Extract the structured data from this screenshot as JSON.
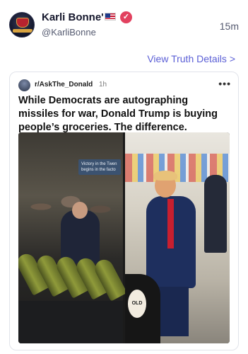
{
  "header": {
    "display_name": "Karli Bonne'",
    "handle": "@KarliBonne",
    "timestamp": "15m",
    "verified_badge": "check-icon",
    "flag": "us-flag-icon"
  },
  "actions": {
    "view_details_label": "View Truth Details",
    "view_details_chevron": ">"
  },
  "embedded_post": {
    "subreddit": "r/AskThe_Donald",
    "age": "1h",
    "menu_glyph": "•••",
    "title": "While Democrats are autographing missiles for war, Donald Trump is buying people’s groceries. The difference.",
    "image_left": {
      "sign_text": "Victory in the Twen begins in the facto"
    },
    "image_right": {
      "bag_text": "OLD"
    }
  },
  "colors": {
    "accent": "#5b5fd6",
    "verified": "#e2415f"
  }
}
